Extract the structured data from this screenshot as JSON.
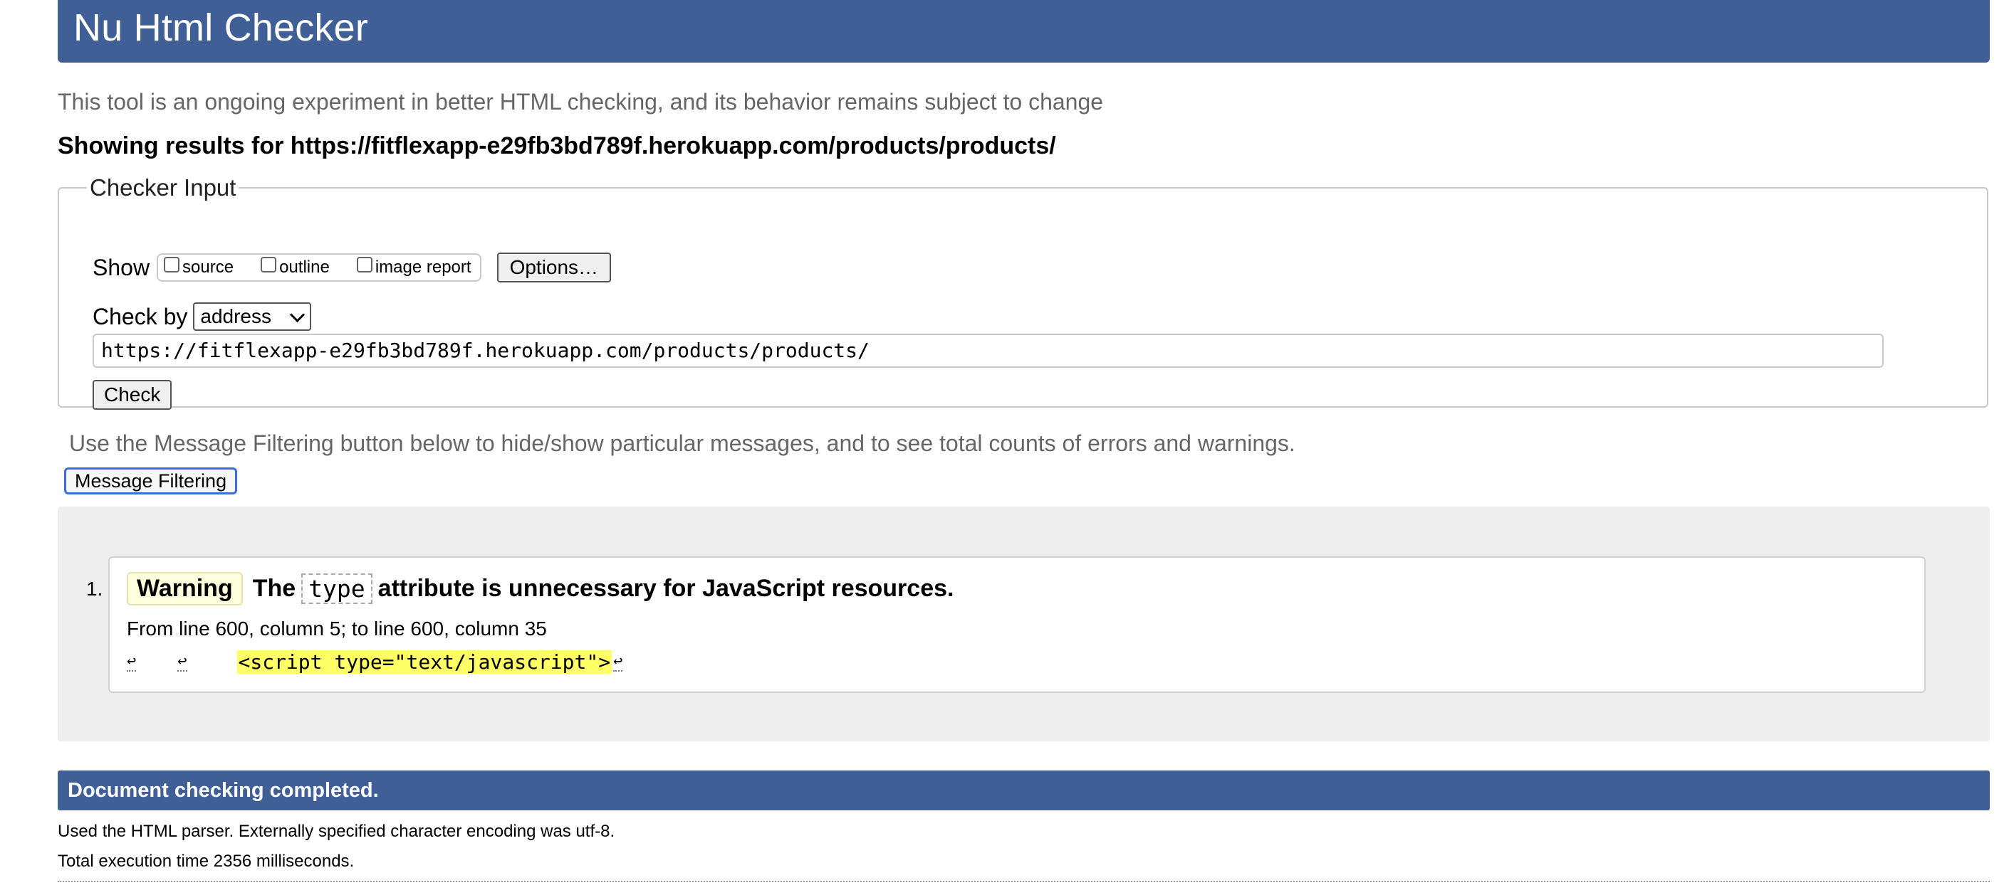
{
  "header": {
    "title": "Nu Html Checker"
  },
  "intro": "This tool is an ongoing experiment in better HTML checking, and its behavior remains subject to change",
  "showing": "Showing results for https://fitflexapp-e29fb3bd789f.herokuapp.com/products/products/",
  "checker_input": {
    "legend": "Checker Input",
    "show_label": "Show",
    "options": [
      {
        "label": "source",
        "checked": false
      },
      {
        "label": "outline",
        "checked": false
      },
      {
        "label": "image report",
        "checked": false
      }
    ],
    "options_button": "Options…",
    "check_by_label": "Check by",
    "check_by_value": "address",
    "url_value": "https://fitflexapp-e29fb3bd789f.herokuapp.com/products/products/",
    "check_button": "Check"
  },
  "filter_note": "Use the Message Filtering button below to hide/show particular messages, and to see total counts of errors and warnings.",
  "message_filtering_button": "Message Filtering",
  "messages": [
    {
      "number": "1.",
      "type": "Warning",
      "text_before": "The",
      "code": "type",
      "text_after": "attribute is unnecessary for JavaScript resources.",
      "location": "From line 600, column 5; to line 600, column 35",
      "extract_highlight": "<script type=\"text/javascript\">",
      "lf_symbol": "↩"
    }
  ],
  "completed": "Document checking completed.",
  "info_parser": "Used the HTML parser. Externally specified character encoding was utf-8.",
  "info_time": "Total execution time 2356 milliseconds.",
  "colors": {
    "header_bg": "#3f5f96",
    "warning_badge_bg": "#ffffdd",
    "highlight": "#ffff66"
  }
}
